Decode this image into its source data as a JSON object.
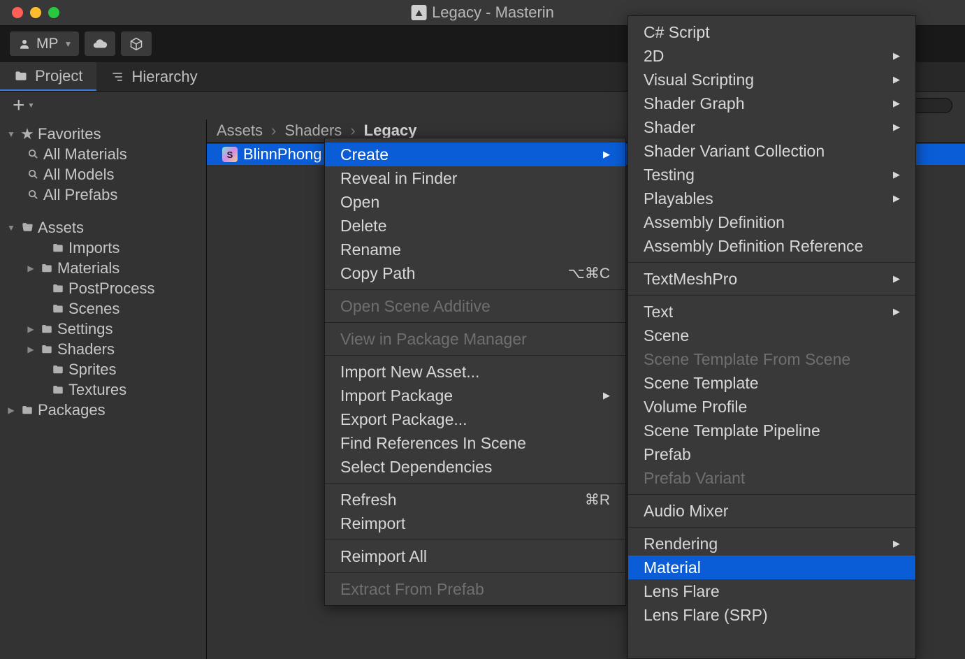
{
  "window": {
    "title": "Legacy - Masterin"
  },
  "toolbar": {
    "mp": "MP"
  },
  "tabs": {
    "project": "Project",
    "hierarchy": "Hierarchy"
  },
  "search": {
    "placeholder": ""
  },
  "sidebar": {
    "favorites": "Favorites",
    "all_materials": "All Materials",
    "all_models": "All Models",
    "all_prefabs": "All Prefabs",
    "assets": "Assets",
    "imports": "Imports",
    "materials": "Materials",
    "postprocess": "PostProcess",
    "scenes": "Scenes",
    "settings": "Settings",
    "shaders": "Shaders",
    "sprites": "Sprites",
    "textures": "Textures",
    "packages": "Packages"
  },
  "breadcrumb": {
    "a": "Assets",
    "b": "Shaders",
    "c": "Legacy"
  },
  "files": {
    "item0": "BlinnPhong"
  },
  "ctx": {
    "create": "Create",
    "reveal": "Reveal in Finder",
    "open": "Open",
    "delete": "Delete",
    "rename": "Rename",
    "copy_path": "Copy Path",
    "copy_path_sc": "⌥⌘C",
    "open_scene_additive": "Open Scene Additive",
    "view_pkg_mgr": "View in Package Manager",
    "import_new_asset": "Import New Asset...",
    "import_package": "Import Package",
    "export_package": "Export Package...",
    "find_refs": "Find References In Scene",
    "select_deps": "Select Dependencies",
    "refresh": "Refresh",
    "refresh_sc": "⌘R",
    "reimport": "Reimport",
    "reimport_all": "Reimport All",
    "extract_prefab": "Extract From Prefab"
  },
  "submenu": {
    "csharp": "C# Script",
    "two_d": "2D",
    "visual_scripting": "Visual Scripting",
    "shader_graph": "Shader Graph",
    "shader": "Shader",
    "shader_variant": "Shader Variant Collection",
    "testing": "Testing",
    "playables": "Playables",
    "asm_def": "Assembly Definition",
    "asm_def_ref": "Assembly Definition Reference",
    "tmp": "TextMeshPro",
    "text": "Text",
    "scene": "Scene",
    "scene_tpl_from_scene": "Scene Template From Scene",
    "scene_tpl": "Scene Template",
    "volume_profile": "Volume Profile",
    "scene_tpl_pipeline": "Scene Template Pipeline",
    "prefab": "Prefab",
    "prefab_variant": "Prefab Variant",
    "audio_mixer": "Audio Mixer",
    "rendering": "Rendering",
    "material": "Material",
    "lens_flare": "Lens Flare",
    "lens_flare_srp": "Lens Flare (SRP)"
  }
}
